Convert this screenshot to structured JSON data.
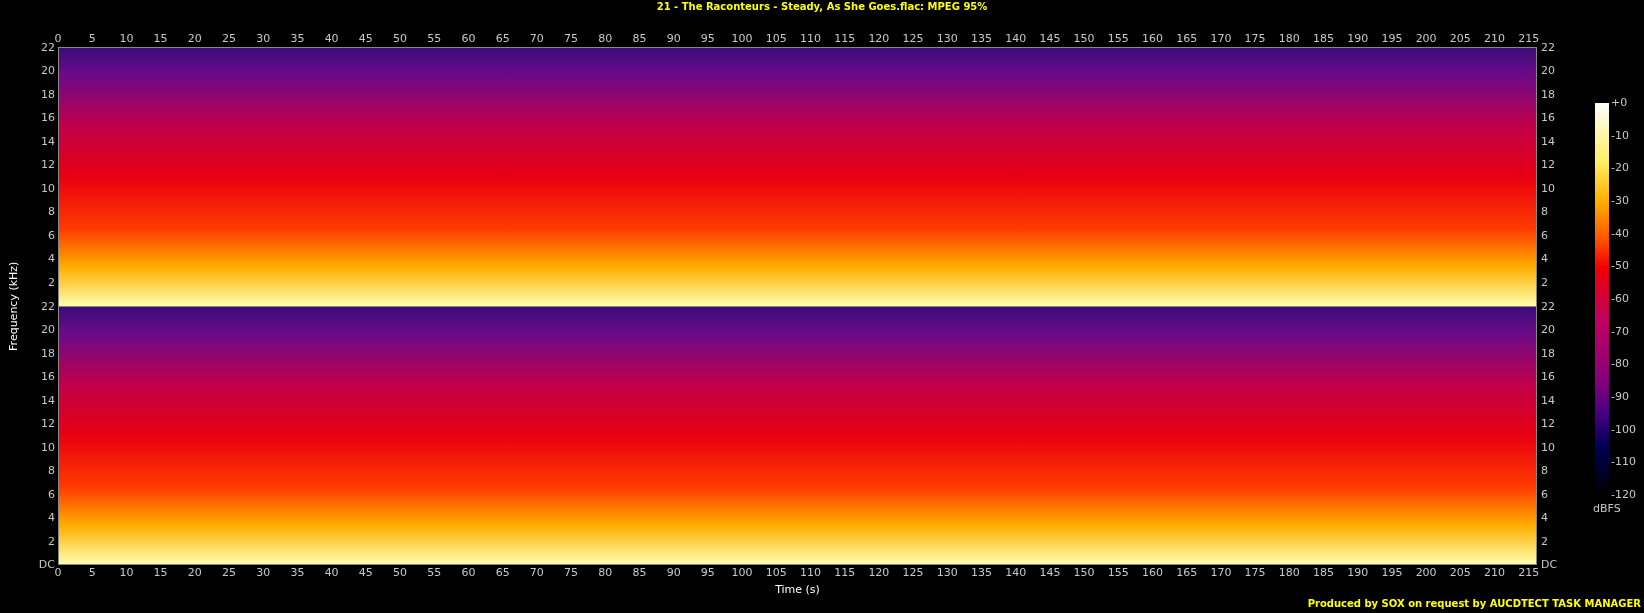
{
  "title": "21 - The Raconteurs - Steady, As She Goes.flac: MPEG 95%",
  "top_axis": {
    "ticks": [
      "0",
      "5",
      "10",
      "15",
      "20",
      "25",
      "30",
      "35",
      "40",
      "45",
      "50",
      "55",
      "60",
      "65",
      "70",
      "75",
      "80",
      "85",
      "90",
      "95",
      "100",
      "105",
      "110",
      "115",
      "120",
      "125",
      "130",
      "135",
      "140",
      "145",
      "150",
      "155",
      "160",
      "165",
      "170",
      "175",
      "180",
      "185",
      "190",
      "195",
      "200",
      "205",
      "210",
      "215"
    ]
  },
  "left_axis": {
    "label": "Frequency (kHz)",
    "channels": [
      {
        "ticks": [
          "22",
          "20",
          "18",
          "16",
          "14",
          "12",
          "10",
          "8",
          "6",
          "4",
          "2"
        ]
      },
      {
        "ticks": [
          "22",
          "20",
          "18",
          "16",
          "14",
          "12",
          "10",
          "8",
          "6",
          "4",
          "2",
          "DC"
        ]
      }
    ]
  },
  "right_axis": {
    "channels": [
      {
        "ticks": [
          "22",
          "20",
          "18",
          "16",
          "14",
          "12",
          "10",
          "8",
          "6",
          "4",
          "2"
        ]
      },
      {
        "ticks": [
          "22",
          "20",
          "18",
          "16",
          "14",
          "12",
          "10",
          "8",
          "6",
          "4",
          "2",
          "DC"
        ]
      }
    ]
  },
  "bottom_axis": {
    "ticks": [
      "0",
      "5",
      "10",
      "15",
      "20",
      "25",
      "30",
      "35",
      "40",
      "45",
      "50",
      "55",
      "60",
      "65",
      "70",
      "75",
      "80",
      "85",
      "90",
      "95",
      "100",
      "105",
      "110",
      "115",
      "120",
      "125",
      "130",
      "135",
      "140",
      "145",
      "150",
      "155",
      "160",
      "165",
      "170",
      "175",
      "180",
      "185",
      "190",
      "195",
      "200",
      "205",
      "210",
      "215"
    ],
    "label": "Time (s)"
  },
  "color_scale": {
    "ticks": [
      "+0",
      "-10",
      "-20",
      "-30",
      "-40",
      "-50",
      "-60",
      "-70",
      "-80",
      "-90",
      "-100",
      "-110",
      "-120"
    ],
    "unit": "dBFS"
  },
  "footer": "Produced by SOX on request by AUCDTECT TASK MANAGER"
}
